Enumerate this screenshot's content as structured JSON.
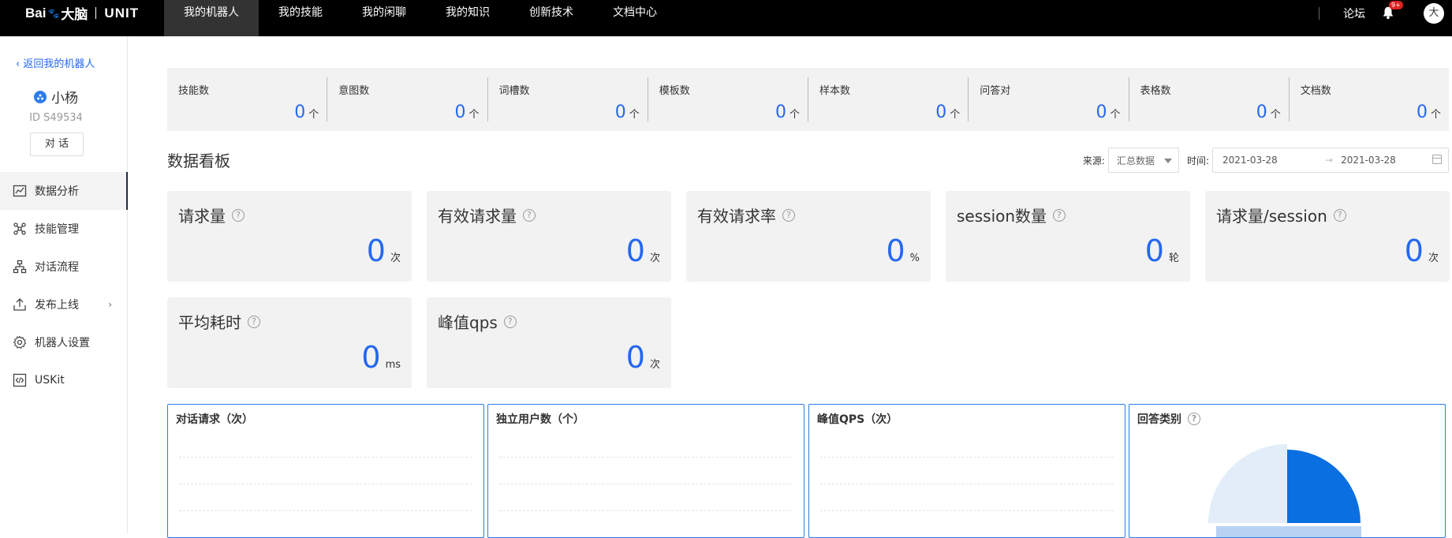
{
  "topbar": {
    "logo_bai": "Bai",
    "logo_cn": "大脑",
    "logo_unit": "UNIT",
    "nav": [
      "我的机器人",
      "我的技能",
      "我的闲聊",
      "我的知识",
      "创新技术",
      "文档中心"
    ],
    "forum": "论坛",
    "badge": "9+",
    "avatar": "大"
  },
  "sidebar": {
    "back": "返回我的机器人",
    "bot_name": "小杨",
    "bot_id": "ID S49534",
    "chat_button": "对 话",
    "items": [
      {
        "label": "数据分析",
        "icon": "trend-chart-icon"
      },
      {
        "label": "技能管理",
        "icon": "nodes-icon"
      },
      {
        "label": "对话流程",
        "icon": "flow-icon"
      },
      {
        "label": "发布上线",
        "icon": "upload-icon"
      },
      {
        "label": "机器人设置",
        "icon": "gear-icon"
      },
      {
        "label": "USKit",
        "icon": "code-icon"
      }
    ]
  },
  "stats": [
    {
      "label": "技能数",
      "value": "0",
      "unit": "个"
    },
    {
      "label": "意图数",
      "value": "0",
      "unit": "个"
    },
    {
      "label": "词槽数",
      "value": "0",
      "unit": "个"
    },
    {
      "label": "模板数",
      "value": "0",
      "unit": "个"
    },
    {
      "label": "样本数",
      "value": "0",
      "unit": "个"
    },
    {
      "label": "问答对",
      "value": "0",
      "unit": "个"
    },
    {
      "label": "表格数",
      "value": "0",
      "unit": "个"
    },
    {
      "label": "文档数",
      "value": "0",
      "unit": "个"
    }
  ],
  "board": {
    "title": "数据看板",
    "source_label": "来源:",
    "source_value": "汇总数据",
    "time_label": "时间:",
    "date_start": "2021-03-28",
    "date_arrow": "→",
    "date_end": "2021-03-28"
  },
  "metrics": [
    {
      "title": "请求量",
      "value": "0",
      "unit": "次"
    },
    {
      "title": "有效请求量",
      "value": "0",
      "unit": "次"
    },
    {
      "title": "有效请求率",
      "value": "0",
      "unit": "%"
    },
    {
      "title": "session数量",
      "value": "0",
      "unit": "轮"
    },
    {
      "title": "请求量/session",
      "value": "0",
      "unit": "次"
    },
    {
      "title": "平均耗时",
      "value": "0",
      "unit": "ms"
    },
    {
      "title": "峰值qps",
      "value": "0",
      "unit": "次"
    }
  ],
  "charts": [
    {
      "title": "对话请求（次）"
    },
    {
      "title": "独立用户数（个）"
    },
    {
      "title": "峰值QPS（次）"
    },
    {
      "title": "回答类别"
    }
  ],
  "colors": {
    "accent": "#2468f2",
    "pie_dark": "#0a6fe0",
    "pie_light": "#e3edf9",
    "pie_mid": "#b8d2f3"
  }
}
